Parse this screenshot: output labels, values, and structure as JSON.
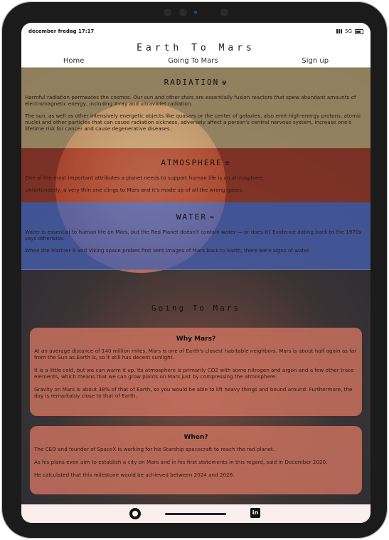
{
  "status": {
    "time": "december fredag 17:17",
    "network": "5G"
  },
  "site": {
    "title": "Earth To Mars"
  },
  "nav": {
    "home": "Home",
    "going": "Going To Mars",
    "signup": "Sign up"
  },
  "sections": {
    "radiation": {
      "title": "RADIATION",
      "icon": "radioactive-icon",
      "p1": "Harmful radiation permeates the cosmos. Our sun and other stars are essentially fusion reactors that spew abundant amounts of electromagnetic energy, including X-ray and ultraviolet radiation.",
      "p2": "The sun, as well as other intensively energetic objects like quasars or the center of galaxies, also emit high-energy protons, atomic nuclei and other particles that can cause radiation sickness, adversely affect a person's central nervous system, increase one's lifetime risk for cancer and cause degenerative diseases."
    },
    "atmosphere": {
      "title": "ATMOSPHERE",
      "icon": "wind-icon",
      "p1": "One of the most important attributes a planet needs to support human life is an atmosphere.",
      "p2": "Unfortunately, a very thin one clings to Mars and it's made up of all the wrong gases."
    },
    "water": {
      "title": "WATER",
      "icon": "water-icon",
      "p1": "Water is essential to human life on Mars, but the Red Planet doesn't contain water — or does it? Evidence dating back to the 1970s says otherwise.",
      "p2": "When the Mariner 9 and Viking space probes first sent images of Mars back to Earth, there were signs of water."
    }
  },
  "going": {
    "title": "Going To Mars",
    "why": {
      "title": "Why Mars?",
      "p1": "At an average distance of 140 million miles, Mars is one of Earth's closest habitable neighbors. Mars is about half again as far from the Sun as Earth is, so it still has decent sunlight.",
      "p2": "It is a little cold, but we can warm it up. Its atmosphere is primarily CO2 with some nitrogen and argon and a few other trace elements, which means that we can grow plants on Mars just by compressing the atmosphere.",
      "p3": "Gravity on Mars is about 38% of that of Earth, so you would be able to lift heavy things and bound around. Furthermore, the day is remarkably close to that of Earth."
    },
    "when": {
      "title": "When?",
      "p1": "The CEO and founder of SpaceX is working for his Starship spacecraft to reach the red planet.",
      "p2": "As his plans even aim to establish a city on Mars and in his first statements in this regard, said in December 2020.",
      "p3": "He calculated that this milestone would be achieved between 2024 and 2026."
    }
  },
  "footer": {
    "github_icon": "github-icon",
    "linkedin_icon": "linkedin-icon",
    "linkedin_text": "in"
  }
}
